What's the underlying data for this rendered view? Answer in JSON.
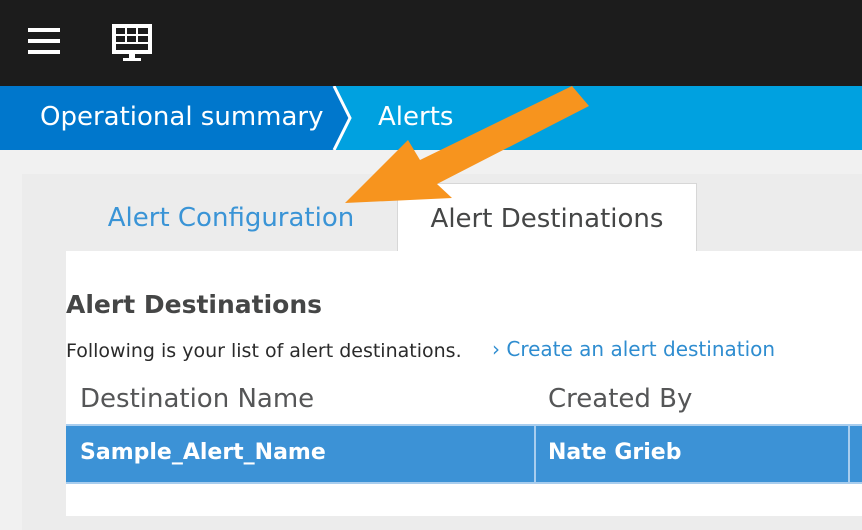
{
  "topbar": {
    "menu_icon": "hamburger-menu-icon",
    "monitor_icon": "dashboard-monitor-icon"
  },
  "breadcrumb": {
    "items": [
      {
        "label": "Operational summary"
      },
      {
        "label": "Alerts"
      }
    ]
  },
  "tabs": [
    {
      "label": "Alert Configuration",
      "active": false
    },
    {
      "label": "Alert Destinations",
      "active": true
    }
  ],
  "section": {
    "title": "Alert Destinations",
    "description": "Following is your list of alert destinations.",
    "create_link": "› Create an alert destination"
  },
  "table": {
    "columns": [
      "Destination Name",
      "Created By"
    ],
    "rows": [
      {
        "name": "Sample_Alert_Name",
        "created_by": "Nate Grieb",
        "selected": true
      }
    ]
  },
  "colors": {
    "topbar": "#1c1c1c",
    "breadcrumb_first": "#0077cc",
    "breadcrumb": "#00a1e0",
    "link": "#2f8dd0",
    "selected_row": "#3c92d6",
    "annotation_arrow": "#f7941e"
  }
}
